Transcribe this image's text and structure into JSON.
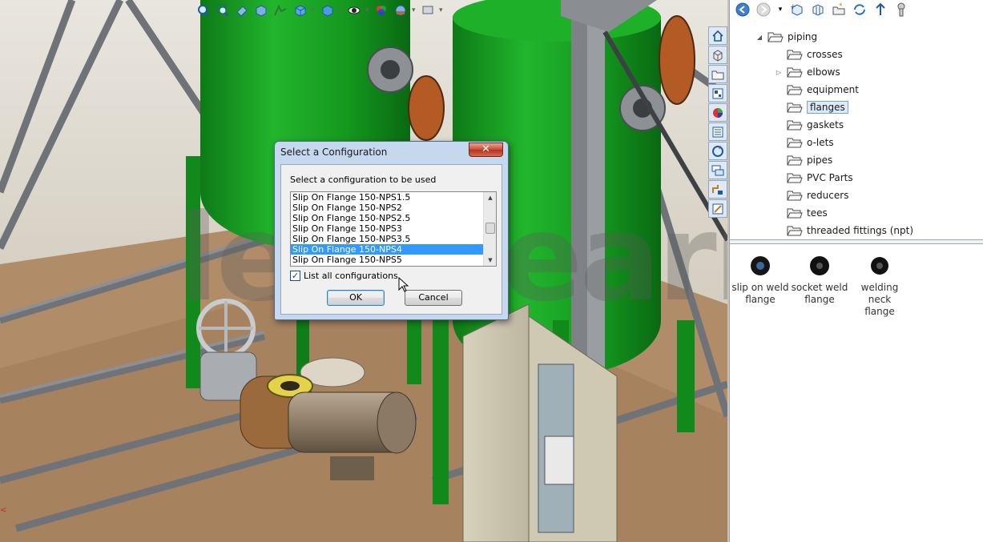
{
  "viewport": {
    "toolbar_icons": [
      "zoom-to-fit-icon",
      "zoom-area-icon",
      "previous-view-icon",
      "section-view-icon",
      "dynamic-annotation-icon",
      "view-orientation-icon",
      "display-style-icon",
      "hide-show-icon",
      "edit-appearance-icon",
      "apply-scene-icon",
      "view-settings-icon"
    ],
    "watermark": "lets-learn.ir"
  },
  "dialog": {
    "title": "Select a Configuration",
    "close_label": "✕",
    "prompt": "Select a configuration to be used",
    "configurations": [
      "Slip On Flange 150-NPS1.5",
      "Slip On Flange 150-NPS2",
      "Slip On Flange 150-NPS2.5",
      "Slip On Flange 150-NPS3",
      "Slip On Flange 150-NPS3.5",
      "Slip On Flange 150-NPS4",
      "Slip On Flange 150-NPS5"
    ],
    "selected_configuration": "Slip On Flange 150-NPS4",
    "list_all_label": "List all configurations",
    "list_all_checked": true,
    "ok_label": "OK",
    "cancel_label": "Cancel"
  },
  "task_pane": {
    "tab_icons": [
      "home-icon",
      "design-library-icon",
      "file-explorer-icon",
      "view-palette-icon",
      "appearances-icon",
      "custom-properties-icon",
      "solidworks-forum-icon",
      "document-recovery-icon",
      "routing-library-icon",
      "toolbox-icon"
    ],
    "nav_icons": [
      "back-icon",
      "forward-icon",
      "history-dropdown-icon",
      "add-to-library-icon",
      "add-file-location-icon",
      "create-new-folder-icon",
      "refresh-icon",
      "up-one-level-icon",
      "toolbox-icon"
    ],
    "tree": {
      "root": "piping",
      "children": [
        {
          "label": "crosses",
          "expandable": false
        },
        {
          "label": "elbows",
          "expandable": true
        },
        {
          "label": "equipment",
          "expandable": false
        },
        {
          "label": "flanges",
          "expandable": false,
          "selected": true
        },
        {
          "label": "gaskets",
          "expandable": false
        },
        {
          "label": "o-lets",
          "expandable": false
        },
        {
          "label": "pipes",
          "expandable": false
        },
        {
          "label": "PVC Parts",
          "expandable": false
        },
        {
          "label": "reducers",
          "expandable": false
        },
        {
          "label": "tees",
          "expandable": false
        },
        {
          "label": "threaded fittings (npt)",
          "expandable": false
        }
      ]
    },
    "thumbnails": [
      {
        "line1": "slip on weld",
        "line2": "flange"
      },
      {
        "line1": "socket weld",
        "line2": "flange"
      },
      {
        "line1": "welding neck",
        "line2": "flange"
      }
    ]
  },
  "colors": {
    "vessel_green": "#15991f",
    "frame_gray": "#7e8287",
    "floor_brown": "#b08c69",
    "selection_blue": "#3399ff",
    "dialog_frame": "#c5d8ee"
  }
}
